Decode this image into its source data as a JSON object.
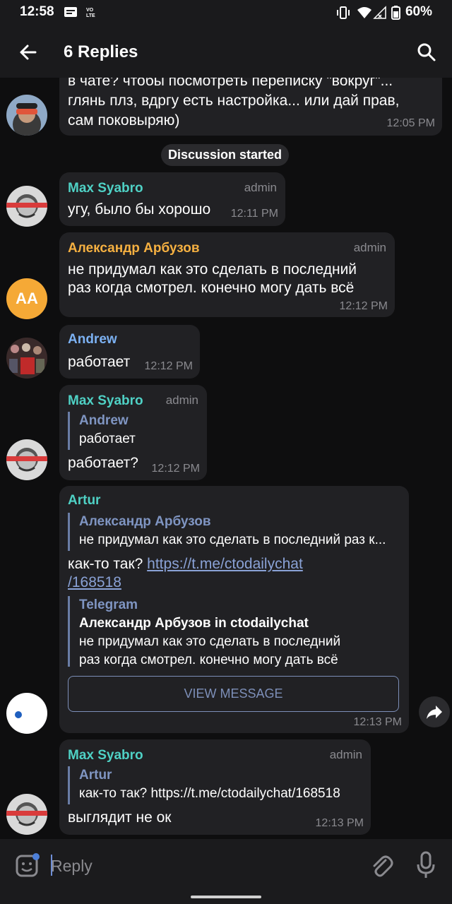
{
  "status_bar": {
    "time": "12:58",
    "battery": "60%",
    "icons": [
      "message-icon",
      "volte-icon",
      "vibrate-icon",
      "wifi-icon",
      "signal-icon",
      "battery-icon"
    ]
  },
  "header": {
    "title": "6 Replies",
    "back_icon": "arrow-left-icon",
    "search_icon": "search-icon"
  },
  "messages": [
    {
      "id": "m0",
      "lines": [
        "в чате? чтобы посмотреть переписку \"вокруг\"...",
        "глянь плз, вдргу есть настройка... или дай прав,",
        "сам поковыряю)"
      ],
      "time": "12:05 PM"
    },
    {
      "id": "divider",
      "text": "Discussion started"
    },
    {
      "id": "m1",
      "sender": "Max Syabro",
      "sender_color": "#4fd1c5",
      "badge": "admin",
      "text": "угу, было бы хорошо",
      "time": "12:11 PM"
    },
    {
      "id": "m2",
      "sender": "Александр Арбузов",
      "sender_color": "#f5b041",
      "badge": "admin",
      "lines": [
        "не придумал как это сделать в последний",
        "раз когда смотрел. конечно могу дать всё"
      ],
      "time": "12:12 PM",
      "avatar_initials": "AA"
    },
    {
      "id": "m3",
      "sender": "Andrew",
      "sender_color": "#7cb1f2",
      "text": "работает",
      "time": "12:12 PM"
    },
    {
      "id": "m4",
      "sender": "Max Syabro",
      "sender_color": "#4fd1c5",
      "badge": "admin",
      "reply_name": "Andrew",
      "reply_text": "работает",
      "text": "работает?",
      "time": "12:12 PM"
    },
    {
      "id": "m5",
      "sender": "Artur",
      "sender_color": "#4fd1c5",
      "reply_name": "Александр Арбузов",
      "reply_text": "не придумал как это сделать в последний раз к...",
      "text_prefix": "как-то так? ",
      "link_part1": "https://t.me/ctodailychat",
      "link_part2": "/168518",
      "preview": {
        "site": "Telegram",
        "title": "Александр Арбузов in ctodailychat",
        "lines": [
          "не придумал как это сделать в последний",
          "раз когда смотрел. конечно могу дать всё"
        ],
        "button": "VIEW MESSAGE"
      },
      "time": "12:13 PM"
    },
    {
      "id": "m6",
      "sender": "Max Syabro",
      "sender_color": "#4fd1c5",
      "badge": "admin",
      "reply_name": "Artur",
      "reply_text": "как-то так? https://t.me/ctodailychat/168518",
      "text": "выглядит не ок",
      "time": "12:13 PM"
    }
  ],
  "compose": {
    "placeholder": "Reply",
    "emoji_icon": "sticker-emoji-icon",
    "attach_icon": "paperclip-icon",
    "mic_icon": "microphone-icon"
  },
  "colors": {
    "background": "#0e0e0f",
    "bubble": "#212124",
    "bar": "#1a1a1c",
    "admin_gray": "#8a8a8f",
    "quote_accent": "#7f95c2"
  }
}
